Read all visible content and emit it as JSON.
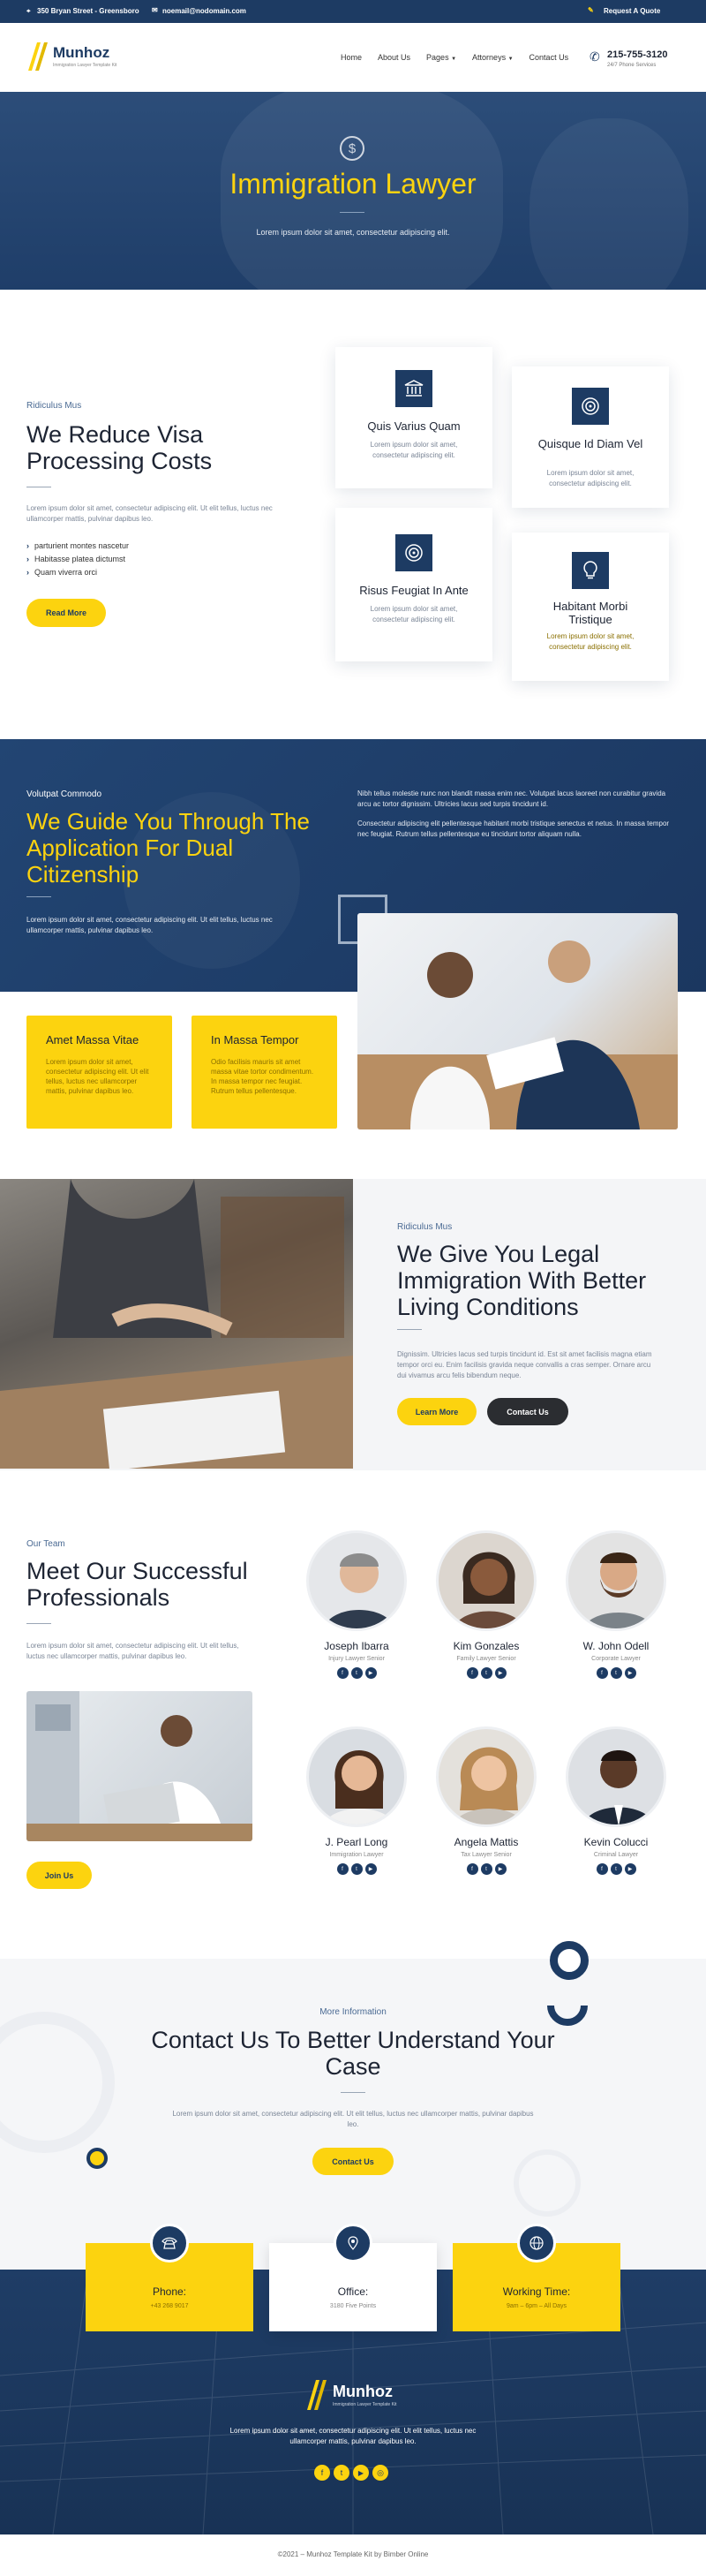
{
  "topbar": {
    "address": "350 Bryan Street - Greensboro",
    "email": "noemail@nodomain.com",
    "quote": "Request A Quote"
  },
  "brand": {
    "name": "Munhoz",
    "tagline": "Immigration Lawyer Template Kit"
  },
  "nav": {
    "items": [
      "Home",
      "About Us",
      "Pages",
      "Attorneys",
      "Contact Us"
    ],
    "phone": "215-755-3120",
    "phone_sub": "24/7 Phone Services"
  },
  "hero": {
    "title": "Immigration Lawyer",
    "subtitle": "Lorem ipsum dolor sit amet, consectetur adipiscing elit."
  },
  "visa": {
    "kicker": "Ridiculus Mus",
    "title": "We Reduce Visa Processing Costs",
    "text": "Lorem ipsum dolor sit amet, consectetur adipiscing elit. Ut elit tellus, luctus nec ullamcorper mattis, pulvinar dapibus leo.",
    "checks": [
      "parturient montes nascetur",
      "Habitasse platea dictumst",
      "Quam viverra orci"
    ],
    "button": "Read More",
    "cards": [
      {
        "title": "Quis Varius Quam",
        "text": "Lorem ipsum dolor sit amet, consectetur adipiscing elit.",
        "icon": "bank-icon"
      },
      {
        "title": "Quisque Id Diam Vel",
        "text": "Lorem ipsum dolor sit amet, consectetur adipiscing elit.",
        "icon": "target-icon"
      },
      {
        "title": "Risus Feugiat In Ante",
        "text": "Lorem ipsum dolor sit amet, consectetur adipiscing elit.",
        "icon": "target-icon"
      },
      {
        "title": "Habitant Morbi Tristique",
        "text": "Lorem ipsum dolor sit amet, consectetur adipiscing elit.",
        "icon": "bulb-icon"
      }
    ]
  },
  "dual": {
    "kicker": "Volutpat Commodo",
    "title": "We Guide You Through The Application For Dual Citizenship",
    "text": "Lorem ipsum dolor sit amet, consectetur adipiscing elit. Ut elit tellus, luctus nec ullamcorper mattis, pulvinar dapibus leo.",
    "para1": "Nibh tellus molestie nunc non blandit massa enim nec. Volutpat lacus laoreet non curabitur gravida arcu ac tortor dignissim. Ultricies lacus sed turpis tincidunt id.",
    "para2": "Consectetur adipiscing elit pellentesque habitant morbi tristique senectus et netus. In massa tempor nec feugiat. Rutrum tellus pellentesque eu tincidunt tortor aliquam nulla.",
    "boxes": [
      {
        "title": "Amet Massa Vitae",
        "text": "Lorem ipsum dolor sit amet, consectetur adipiscing elit. Ut elit tellus, luctus nec ullamcorper mattis, pulvinar dapibus leo."
      },
      {
        "title": "In Massa Tempor",
        "text": "Odio facilisis mauris sit amet massa vitae tortor condimentum. In massa tempor nec feugiat. Rutrum tellus pellentesque."
      }
    ]
  },
  "legal": {
    "kicker": "Ridiculus Mus",
    "title": "We Give You Legal Immigration With Better Living Conditions",
    "text": "Dignissim. Ultricies lacus sed turpis tincidunt id. Est sit amet facilisis magna etiam tempor orci eu. Enim facilisis gravida neque convallis a cras semper. Ornare arcu dui vivamus arcu felis bibendum neque.",
    "btn1": "Learn More",
    "btn2": "Contact Us"
  },
  "team": {
    "kicker": "Our Team",
    "title": "Meet Our Successful Professionals",
    "text": "Lorem ipsum dolor sit amet, consectetur adipiscing elit. Ut elit tellus, luctus nec ullamcorper mattis, pulvinar dapibus leo.",
    "button": "Join Us",
    "members": [
      {
        "name": "Joseph Ibarra",
        "role": "Injury Lawyer Senior"
      },
      {
        "name": "Kim Gonzales",
        "role": "Family Lawyer Senior"
      },
      {
        "name": "W. John Odell",
        "role": "Corporate Lawyer"
      },
      {
        "name": "J. Pearl Long",
        "role": "Immigration Lawyer"
      },
      {
        "name": "Angela Mattis",
        "role": "Tax Lawyer Senior"
      },
      {
        "name": "Kevin Colucci",
        "role": "Criminal Lawyer"
      }
    ]
  },
  "contact": {
    "kicker": "More Information",
    "title": "Contact Us To Better Understand Your Case",
    "text": "Lorem ipsum dolor sit amet, consectetur adipiscing elit. Ut elit tellus, luctus nec ullamcorper mattis, pulvinar dapibus leo.",
    "button": "Contact Us"
  },
  "info": [
    {
      "title": "Phone:",
      "value": "+43 268 9017",
      "icon": "phone-icon"
    },
    {
      "title": "Office:",
      "value": "3180 Five Points",
      "icon": "location-icon"
    },
    {
      "title": "Working Time:",
      "value": "9am – 6pm – All Days",
      "icon": "globe-icon"
    }
  ],
  "footer": {
    "text": "Lorem ipsum dolor sit amet, consectetur adipiscing elit. Ut elit tellus, luctus nec ullamcorper mattis, pulvinar dapibus leo.",
    "copyright": "©2021 – Munhoz Template Kit by Bimber Online"
  },
  "colors": {
    "navy": "#1d3b63",
    "gold": "#fcd30f"
  }
}
